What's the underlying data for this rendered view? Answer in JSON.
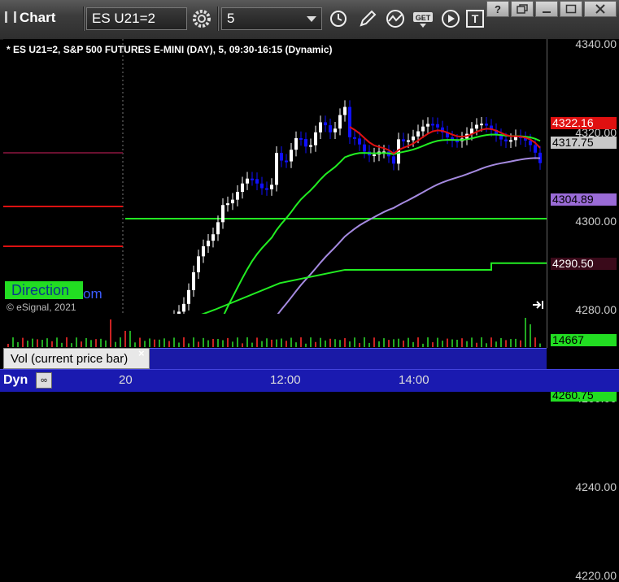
{
  "toolbar": {
    "title": "Chart",
    "symbol": "ES U21=2",
    "interval": "5",
    "icons": [
      "settings-gear-icon",
      "clock-icon",
      "pencil-icon",
      "studies-icon",
      "get-icon",
      "play-icon",
      "text-tool-icon"
    ],
    "get_label": "GET",
    "text_tool_label": "T"
  },
  "window_controls": {
    "help": "?",
    "restore": "restore",
    "minimize": "minimize",
    "close": "close"
  },
  "chart": {
    "title": "* ES U21=2, S&P 500 FUTURES E-MINI (DAY), 5, 09:30-16:15 (Dynamic)",
    "copyright": "© eSignal, 2021",
    "direction_label": "Direction",
    "direction_tail": "om",
    "y_ticks": [
      "4340.00",
      "4320.00",
      "4300.00",
      "4280.00",
      "4260.00",
      "4240.00",
      "4220.00"
    ],
    "price_tags": [
      {
        "label": "4322.16",
        "bg": "#e01010",
        "fg": "#ffffff"
      },
      {
        "label": "4317.75",
        "bg": "#c8c8c8",
        "fg": "#000000"
      },
      {
        "label": "4304.89",
        "bg": "#9a6bd6",
        "fg": "#000000"
      },
      {
        "label": "4290.50",
        "bg": "#3a0a1a",
        "fg": "#ffffff"
      },
      {
        "label": "4260.75",
        "bg": "#22dd22",
        "fg": "#000000"
      }
    ],
    "colors": {
      "up": "#ffffff",
      "down": "#1010ff",
      "ema_short": "#e01010",
      "ema_long": "#22ee22",
      "vwap": "#a58ae0",
      "green_level": "#22ee22",
      "red_level": "#dd1111"
    }
  },
  "volume": {
    "label": "Vol (current price bar)",
    "close_glyph": "×",
    "last_value": "14667",
    "last_value_bg": "#22dd22"
  },
  "time_axis": {
    "ticks": [
      "20",
      "12:00",
      "14:00"
    ],
    "dyn_label": "Dyn"
  }
}
